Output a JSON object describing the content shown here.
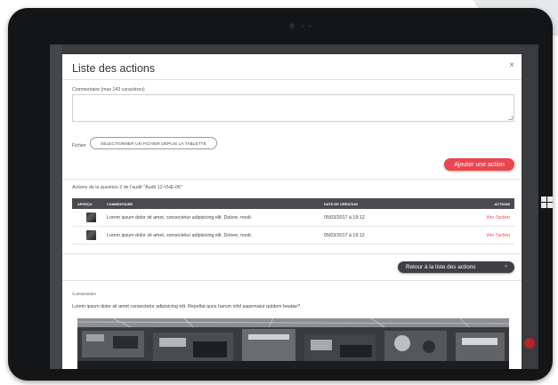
{
  "modal": {
    "title": "Liste des actions",
    "close_label": "×",
    "comment_label": "Commentaire (max 143 caractères)",
    "comment_value": "",
    "file_label": "Fichier",
    "file_button": "SELECTIONNER UN FICHIER DEPUIS LA TABLETTE",
    "add_action_button": "Ajouter une action",
    "actions_heading": "Actions de la question 2 de l'audit \"Audit 12-VHE-06\"",
    "table": {
      "columns": [
        "APERÇU",
        "COMMENTAIRE",
        "DATE DE CRÉATION",
        "ACTIONS"
      ],
      "rows": [
        {
          "comment": "Lorem ipsum dolor sit amet, consectetur adipisicing elit. Dolore, modi.",
          "date": "05/03/2017 à 19:12",
          "action": "Voir l'action"
        },
        {
          "comment": "Lorem ipsum dolor sit amet, consectetur adipisicing elit. Dolore, modi.",
          "date": "05/03/2017 à 19:12",
          "action": "Voir l'action"
        }
      ]
    },
    "back_button": "Retour à la liste des actions",
    "back_chevron": "<",
    "detail": {
      "comment_heading": "Commentaire",
      "comment_text": "Lorem ipsum dolor sit amet consectetur adipisicing elit. Repellat quos harum nihil aspernatur quidem beatae?"
    }
  },
  "colors": {
    "accent_red": "#e8474f",
    "table_header": "#4a4b4f",
    "dark_button": "#3f4044",
    "bezel": "#141516"
  },
  "icons": [
    "close-icon",
    "chevron-left-icon",
    "windows-logo-icon",
    "camera-icon"
  ]
}
